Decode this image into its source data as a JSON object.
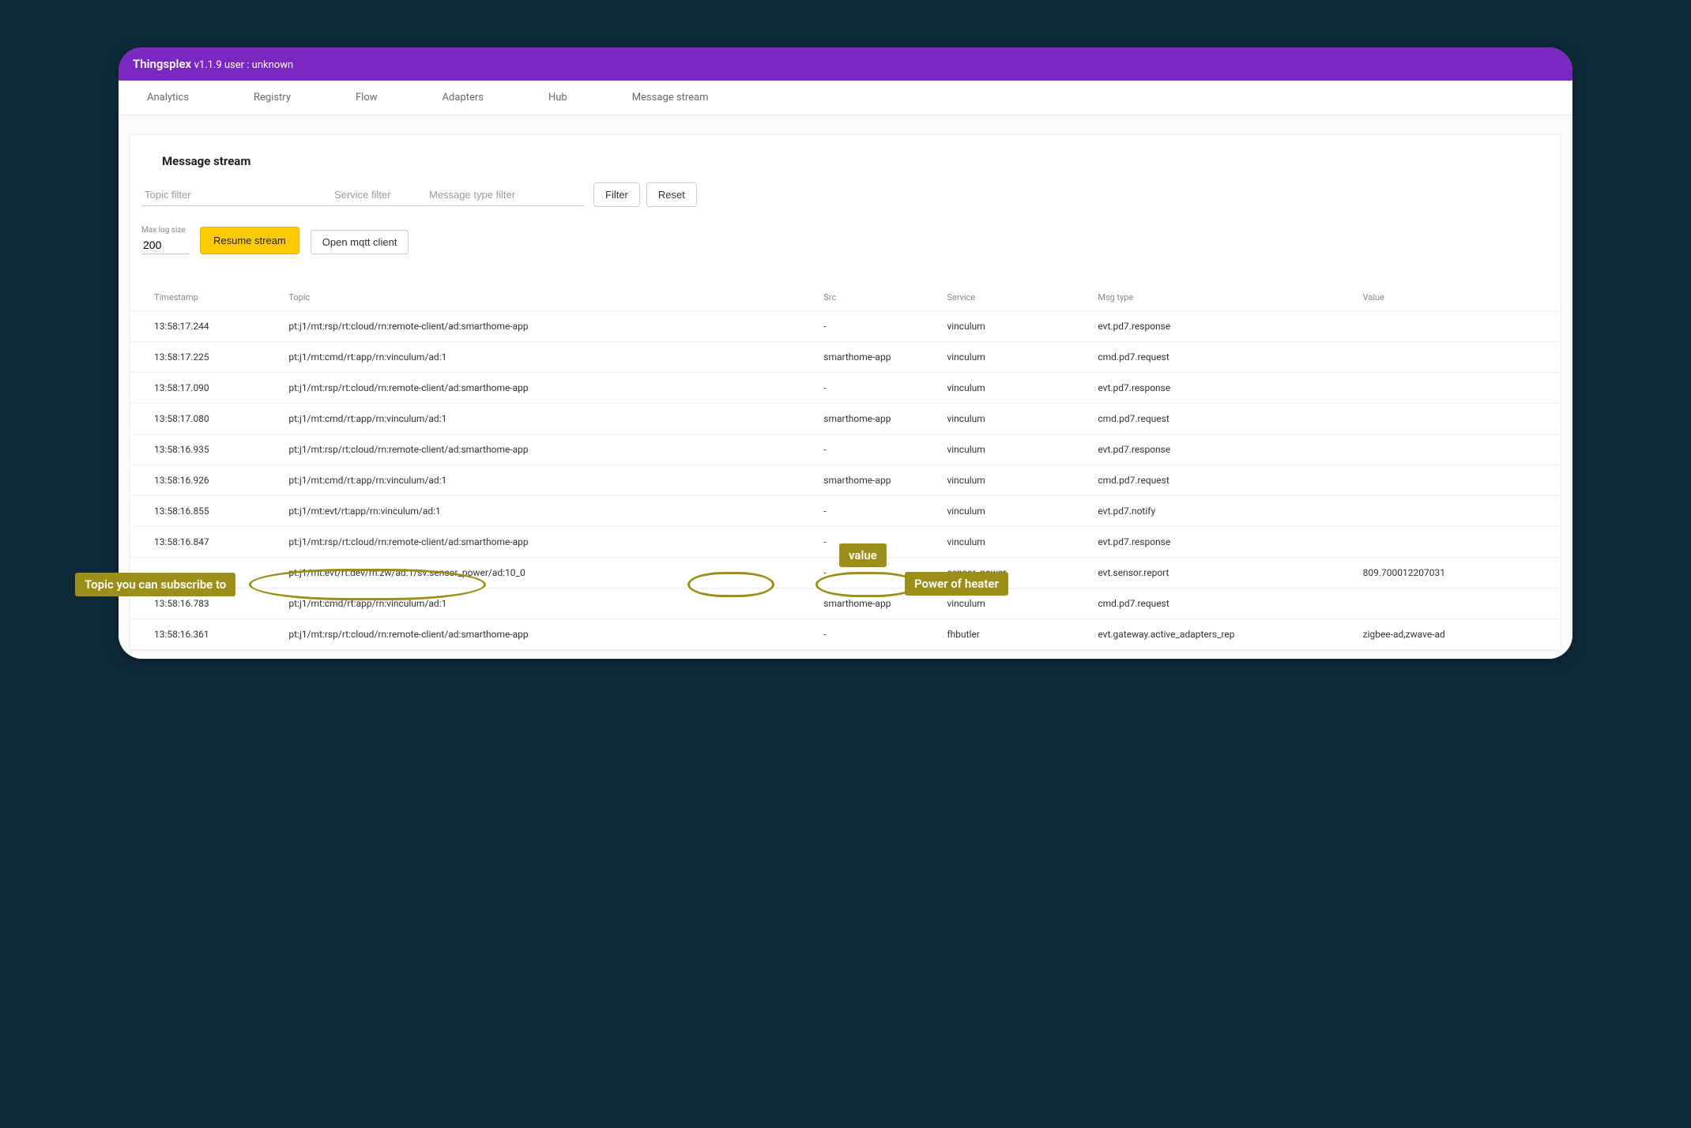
{
  "header": {
    "brand": "Thingsplex",
    "meta": "v1.1.9 user : unknown"
  },
  "nav": {
    "items": [
      "Analytics",
      "Registry",
      "Flow",
      "Adapters",
      "Hub",
      "Message stream"
    ]
  },
  "section": {
    "title": "Message stream"
  },
  "filters": {
    "topic_placeholder": "Topic filter",
    "service_placeholder": "Service filter",
    "msgtype_placeholder": "Message type filter",
    "filter_btn": "Filter",
    "reset_btn": "Reset"
  },
  "controls": {
    "maxlog_label": "Max log size",
    "maxlog_value": "200",
    "resume_btn": "Resume stream",
    "mqtt_btn": "Open mqtt client"
  },
  "table": {
    "headers": {
      "timestamp": "Timestamp",
      "topic": "Topic",
      "src": "Src",
      "service": "Service",
      "msgtype": "Msg type",
      "value": "Value"
    },
    "rows": [
      {
        "ts": "13:58:17.244",
        "topic": "pt:j1/mt:rsp/rt:cloud/rn:remote-client/ad:smarthome-app",
        "src": "-",
        "svc": "vinculum",
        "msg": "evt.pd7.response",
        "val": ""
      },
      {
        "ts": "13:58:17.225",
        "topic": "pt:j1/mt:cmd/rt:app/rn:vinculum/ad:1",
        "src": "smarthome-app",
        "svc": "vinculum",
        "msg": "cmd.pd7.request",
        "val": ""
      },
      {
        "ts": "13:58:17.090",
        "topic": "pt:j1/mt:rsp/rt:cloud/rn:remote-client/ad:smarthome-app",
        "src": "-",
        "svc": "vinculum",
        "msg": "evt.pd7.response",
        "val": ""
      },
      {
        "ts": "13:58:17.080",
        "topic": "pt:j1/mt:cmd/rt:app/rn:vinculum/ad:1",
        "src": "smarthome-app",
        "svc": "vinculum",
        "msg": "cmd.pd7.request",
        "val": ""
      },
      {
        "ts": "13:58:16.935",
        "topic": "pt:j1/mt:rsp/rt:cloud/rn:remote-client/ad:smarthome-app",
        "src": "-",
        "svc": "vinculum",
        "msg": "evt.pd7.response",
        "val": ""
      },
      {
        "ts": "13:58:16.926",
        "topic": "pt:j1/mt:cmd/rt:app/rn:vinculum/ad:1",
        "src": "smarthome-app",
        "svc": "vinculum",
        "msg": "cmd.pd7.request",
        "val": ""
      },
      {
        "ts": "13:58:16.855",
        "topic": "pt:j1/mt:evt/rt:app/rn:vinculum/ad:1",
        "src": "-",
        "svc": "vinculum",
        "msg": "evt.pd7.notify",
        "val": ""
      },
      {
        "ts": "13:58:16.847",
        "topic": "pt:j1/mt:rsp/rt:cloud/rn:remote-client/ad:smarthome-app",
        "src": "-",
        "svc": "vinculum",
        "msg": "evt.pd7.response",
        "val": ""
      },
      {
        "ts": "",
        "topic": "pt:j1/mt:evt/rt:dev/rn:zw/ad:1/sv:sensor_power/ad:10_0",
        "src": "-",
        "svc": "sensor_power",
        "msg": "evt.sensor.report",
        "val": "809.700012207031"
      },
      {
        "ts": "13:58:16.783",
        "topic": "pt:j1/mt:cmd/rt:app/rn:vinculum/ad:1",
        "src": "smarthome-app",
        "svc": "vinculum",
        "msg": "cmd.pd7.request",
        "val": ""
      },
      {
        "ts": "13:58:16.361",
        "topic": "pt:j1/mt:rsp/rt:cloud/rn:remote-client/ad:smarthome-app",
        "src": "-",
        "svc": "fhbutler",
        "msg": "evt.gateway.active_adapters_rep",
        "val": "zigbee-ad,zwave-ad"
      }
    ]
  },
  "annotations": {
    "topic_label": "Topic you can subscribe to",
    "value_label": "value",
    "power_label": "Power of heater"
  }
}
